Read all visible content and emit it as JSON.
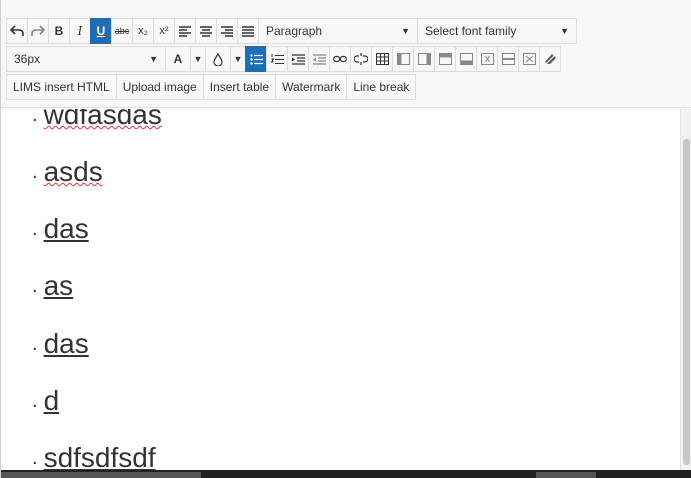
{
  "toolbar": {
    "row1": {
      "undo_icon": "undo-icon",
      "redo_icon": "redo-icon",
      "bold": "B",
      "italic": "I",
      "underline": "U",
      "strikethrough": "abc",
      "subscript": "x₂",
      "superscript": "x²",
      "block_format": "Paragraph",
      "font_family_placeholder": "Select font family"
    },
    "row2": {
      "font_size": "36px",
      "text_color": "A"
    },
    "row3": {
      "lims_insert_html": "LIMS insert HTML",
      "upload_image": "Upload image",
      "insert_table": "Insert table",
      "watermark": "Watermark",
      "line_break": "Line break"
    }
  },
  "content": {
    "items": [
      "wdfasdas",
      "asds",
      "das",
      "as",
      "das",
      "d",
      "sdfsdfsdf"
    ],
    "bullet": "."
  },
  "colors": {
    "accent": "#1c6fb5",
    "toolbar_bg": "#f7f7f7",
    "text": "#333333"
  }
}
